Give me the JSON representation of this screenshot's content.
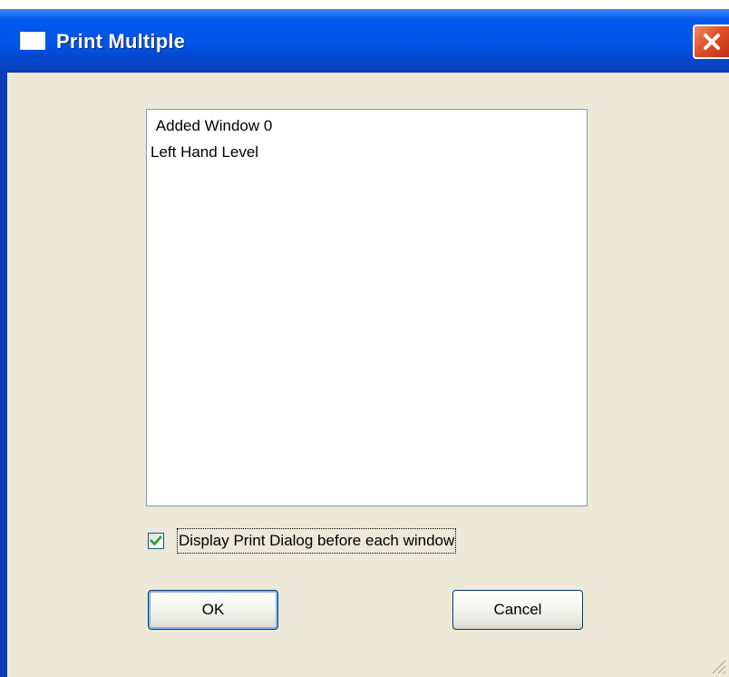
{
  "window": {
    "title": "Print Multiple",
    "icons": {
      "title": "window-icon",
      "close": "close-icon",
      "grip": "resize-grip-icon"
    },
    "colors": {
      "titlebar": "#0055e5",
      "close": "#e0502a",
      "face": "#ece9d8"
    }
  },
  "list": {
    "items": [
      " Added Window 0",
      "Left Hand Level"
    ]
  },
  "options": {
    "display_print_dialog": {
      "label": "Display Print Dialog before each window",
      "checked": true
    }
  },
  "buttons": {
    "ok": "OK",
    "cancel": "Cancel"
  }
}
